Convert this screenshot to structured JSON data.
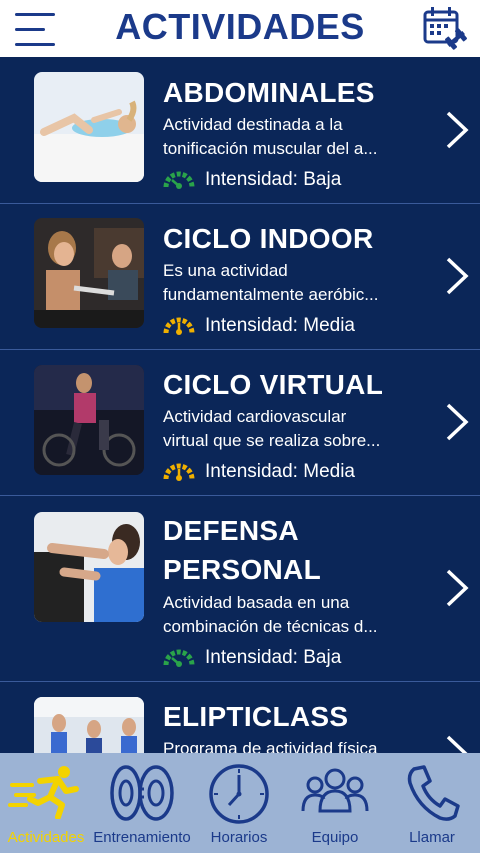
{
  "header": {
    "title": "ACTIVIDADES"
  },
  "activities": [
    {
      "name": "ABDOMINALES",
      "desc1": "Actividad destinada a la",
      "desc2": "tonificación muscular del a...",
      "intensity": "Intensidad: Baja"
    },
    {
      "name": "CICLO INDOOR",
      "desc1": "Es una actividad",
      "desc2": "fundamentalmente aeróbic...",
      "intensity": "Intensidad: Media"
    },
    {
      "name": "CICLO VIRTUAL",
      "desc1": "Actividad cardiovascular",
      "desc2": "virtual que se realiza sobre...",
      "intensity": "Intensidad: Media"
    },
    {
      "name1": "DEFENSA",
      "name2": "PERSONAL",
      "desc1": "Actividad basada en una",
      "desc2": "combinación de técnicas d...",
      "intensity": "Intensidad: Baja"
    },
    {
      "name": "ELIPTICLASS",
      "desc1": "Programa de actividad física"
    }
  ],
  "tabs": [
    {
      "label": "Actividades",
      "icon": "runner-icon",
      "active": true
    },
    {
      "label": "Entrenamiento",
      "icon": "weights-icon"
    },
    {
      "label": "Horarios",
      "icon": "clock-icon"
    },
    {
      "label": "Equipo",
      "icon": "team-icon"
    },
    {
      "label": "Llamar",
      "icon": "phone-icon"
    }
  ],
  "colors": {
    "brand": "#1b3a8a",
    "list_bg": "#0b2658",
    "tabbar_bg": "#9cb3d4",
    "active": "#f3d300",
    "gauge_low": "#2aa34a",
    "gauge_medium": "#f0b000"
  }
}
